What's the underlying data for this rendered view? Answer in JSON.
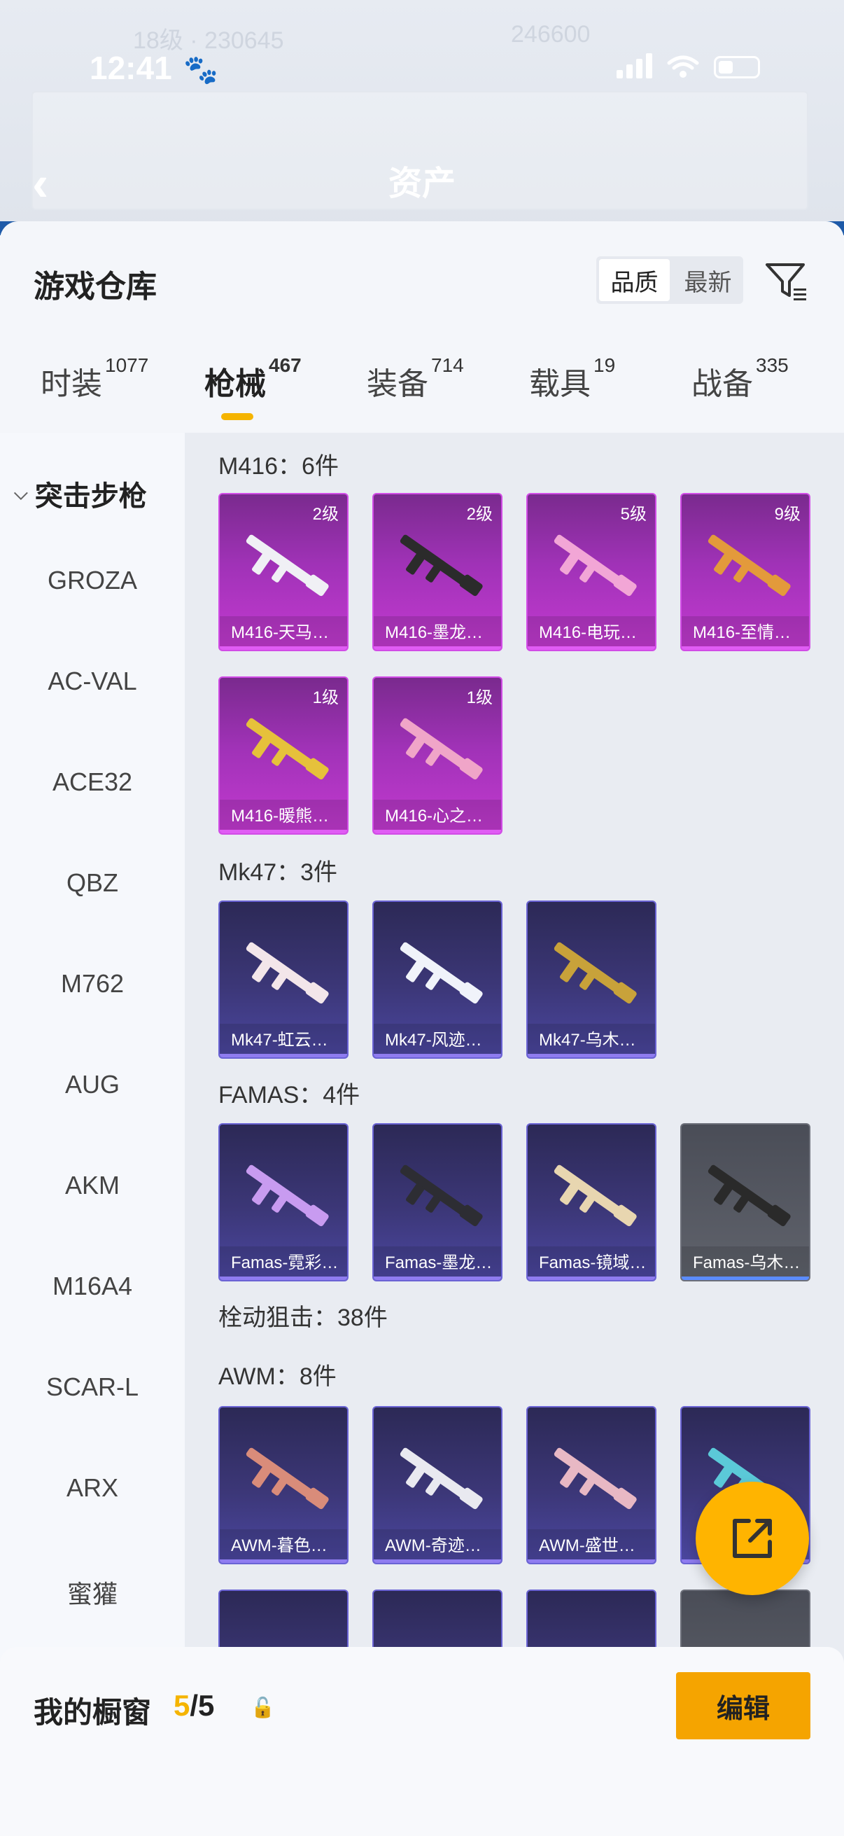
{
  "status": {
    "time": "12:41"
  },
  "header": {
    "title": "资产"
  },
  "sheet": {
    "title": "游戏仓库",
    "sort": {
      "quality": "品质",
      "latest": "最新"
    },
    "tabs": [
      {
        "label": "时装",
        "count": "1077"
      },
      {
        "label": "枪械",
        "count": "467"
      },
      {
        "label": "装备",
        "count": "714"
      },
      {
        "label": "载具",
        "count": "19"
      },
      {
        "label": "战备",
        "count": "335"
      }
    ]
  },
  "sidebar": {
    "category": "突击步枪",
    "items": [
      "GROZA",
      "AC-VAL",
      "ACE32",
      "QBZ",
      "M762",
      "AUG",
      "AKM",
      "M16A4",
      "SCAR-L",
      "ARX",
      "蜜獾"
    ]
  },
  "sections": {
    "m416": "M416：6件",
    "mk47": "Mk47：3件",
    "famas": "FAMAS：4件",
    "bolt": "栓动狙击：38件",
    "awm": "AWM：8件"
  },
  "cards": {
    "m416": [
      {
        "name": "M416-天马…",
        "level": "2级"
      },
      {
        "name": "M416-墨龙…",
        "level": "2级"
      },
      {
        "name": "M416-电玩…",
        "level": "5级"
      },
      {
        "name": "M416-至情…",
        "level": "9级"
      },
      {
        "name": "M416-暖熊…",
        "level": "1级"
      },
      {
        "name": "M416-心之…",
        "level": "1级"
      }
    ],
    "mk47": [
      {
        "name": "Mk47-虹云…"
      },
      {
        "name": "Mk47-风迹…"
      },
      {
        "name": "Mk47-乌木…"
      }
    ],
    "famas": [
      {
        "name": "Famas-霓彩…"
      },
      {
        "name": "Famas-墨龙…"
      },
      {
        "name": "Famas-镜域…"
      },
      {
        "name": "Famas-乌木…"
      }
    ],
    "awm": [
      {
        "name": "AWM-暮色…"
      },
      {
        "name": "AWM-奇迹…"
      },
      {
        "name": "AWM-盛世…"
      }
    ]
  },
  "showcase": {
    "title": "我的橱窗",
    "current": "5",
    "sep": "/",
    "total": "5",
    "edit_label": "编辑"
  },
  "colors": {
    "accent": "#f5b400",
    "pink_card": "#c33ad0",
    "purple_card": "#3c3778",
    "gray_card": "#60636c"
  },
  "icons": [
    "back-arrow-icon",
    "filter-icon",
    "share-icon",
    "lock-icon",
    "chevron-down-icon"
  ]
}
